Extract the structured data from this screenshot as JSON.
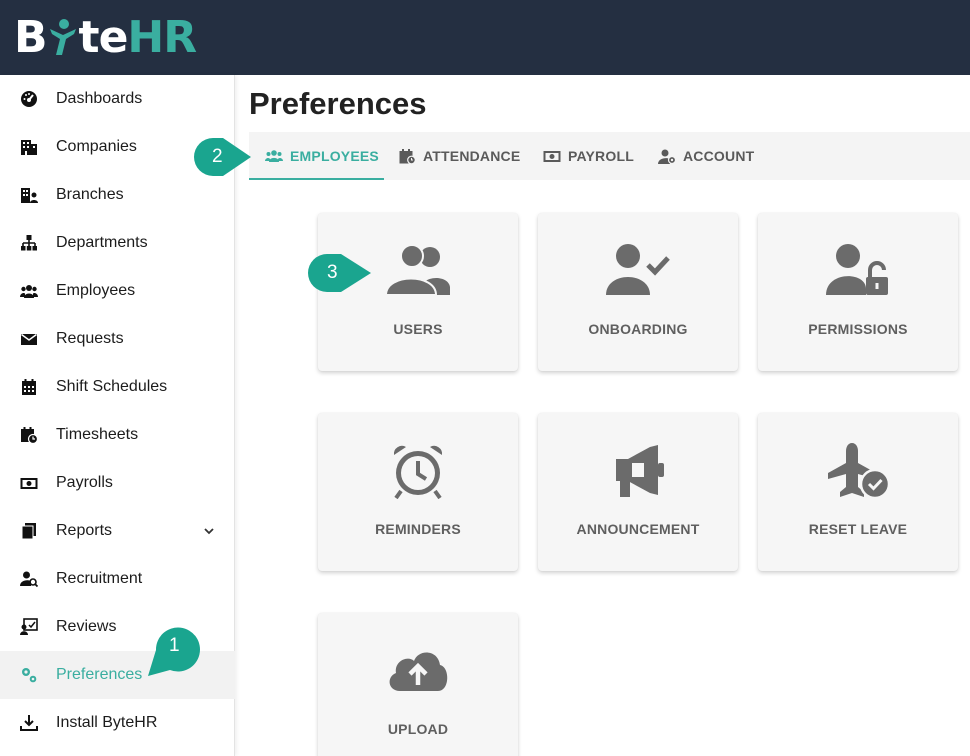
{
  "app": {
    "logo_prefix": "B",
    "logo_mid": "te",
    "logo_suffix": "HR"
  },
  "page": {
    "title": "Preferences"
  },
  "sidebar": {
    "items": [
      {
        "label": "Dashboards",
        "icon": "dashboard-icon"
      },
      {
        "label": "Companies",
        "icon": "companies-icon"
      },
      {
        "label": "Branches",
        "icon": "branches-icon"
      },
      {
        "label": "Departments",
        "icon": "departments-icon"
      },
      {
        "label": "Employees",
        "icon": "employees-icon"
      },
      {
        "label": "Requests",
        "icon": "requests-icon"
      },
      {
        "label": "Shift Schedules",
        "icon": "calendar-icon"
      },
      {
        "label": "Timesheets",
        "icon": "timesheets-icon"
      },
      {
        "label": "Payrolls",
        "icon": "payrolls-icon"
      },
      {
        "label": "Reports",
        "icon": "reports-icon",
        "expandable": true
      },
      {
        "label": "Recruitment",
        "icon": "recruitment-icon"
      },
      {
        "label": "Reviews",
        "icon": "reviews-icon"
      },
      {
        "label": "Preferences",
        "icon": "preferences-icon",
        "active": true
      },
      {
        "label": "Install ByteHR",
        "icon": "download-icon"
      }
    ]
  },
  "tabs": [
    {
      "label": "EMPLOYEES",
      "icon": "employees-icon",
      "active": true
    },
    {
      "label": "ATTENDANCE",
      "icon": "attendance-icon"
    },
    {
      "label": "PAYROLL",
      "icon": "payroll-icon"
    },
    {
      "label": "ACCOUNT",
      "icon": "account-icon"
    }
  ],
  "cards": [
    {
      "label": "USERS",
      "icon": "users-icon"
    },
    {
      "label": "ONBOARDING",
      "icon": "user-check-icon"
    },
    {
      "label": "PERMISSIONS",
      "icon": "user-lock-icon"
    },
    {
      "label": "REMINDERS",
      "icon": "alarm-clock-icon"
    },
    {
      "label": "ANNOUNCEMENT",
      "icon": "megaphone-icon"
    },
    {
      "label": "RESET LEAVE",
      "icon": "plane-check-icon"
    },
    {
      "label": "UPLOAD",
      "icon": "cloud-upload-icon"
    }
  ],
  "callouts": [
    {
      "label": "1"
    },
    {
      "label": "2"
    },
    {
      "label": "3"
    }
  ],
  "colors": {
    "accent": "#3aaea0",
    "header": "#242f41",
    "icon_gray": "#6b6b6b",
    "callout": "#1aa58f"
  }
}
